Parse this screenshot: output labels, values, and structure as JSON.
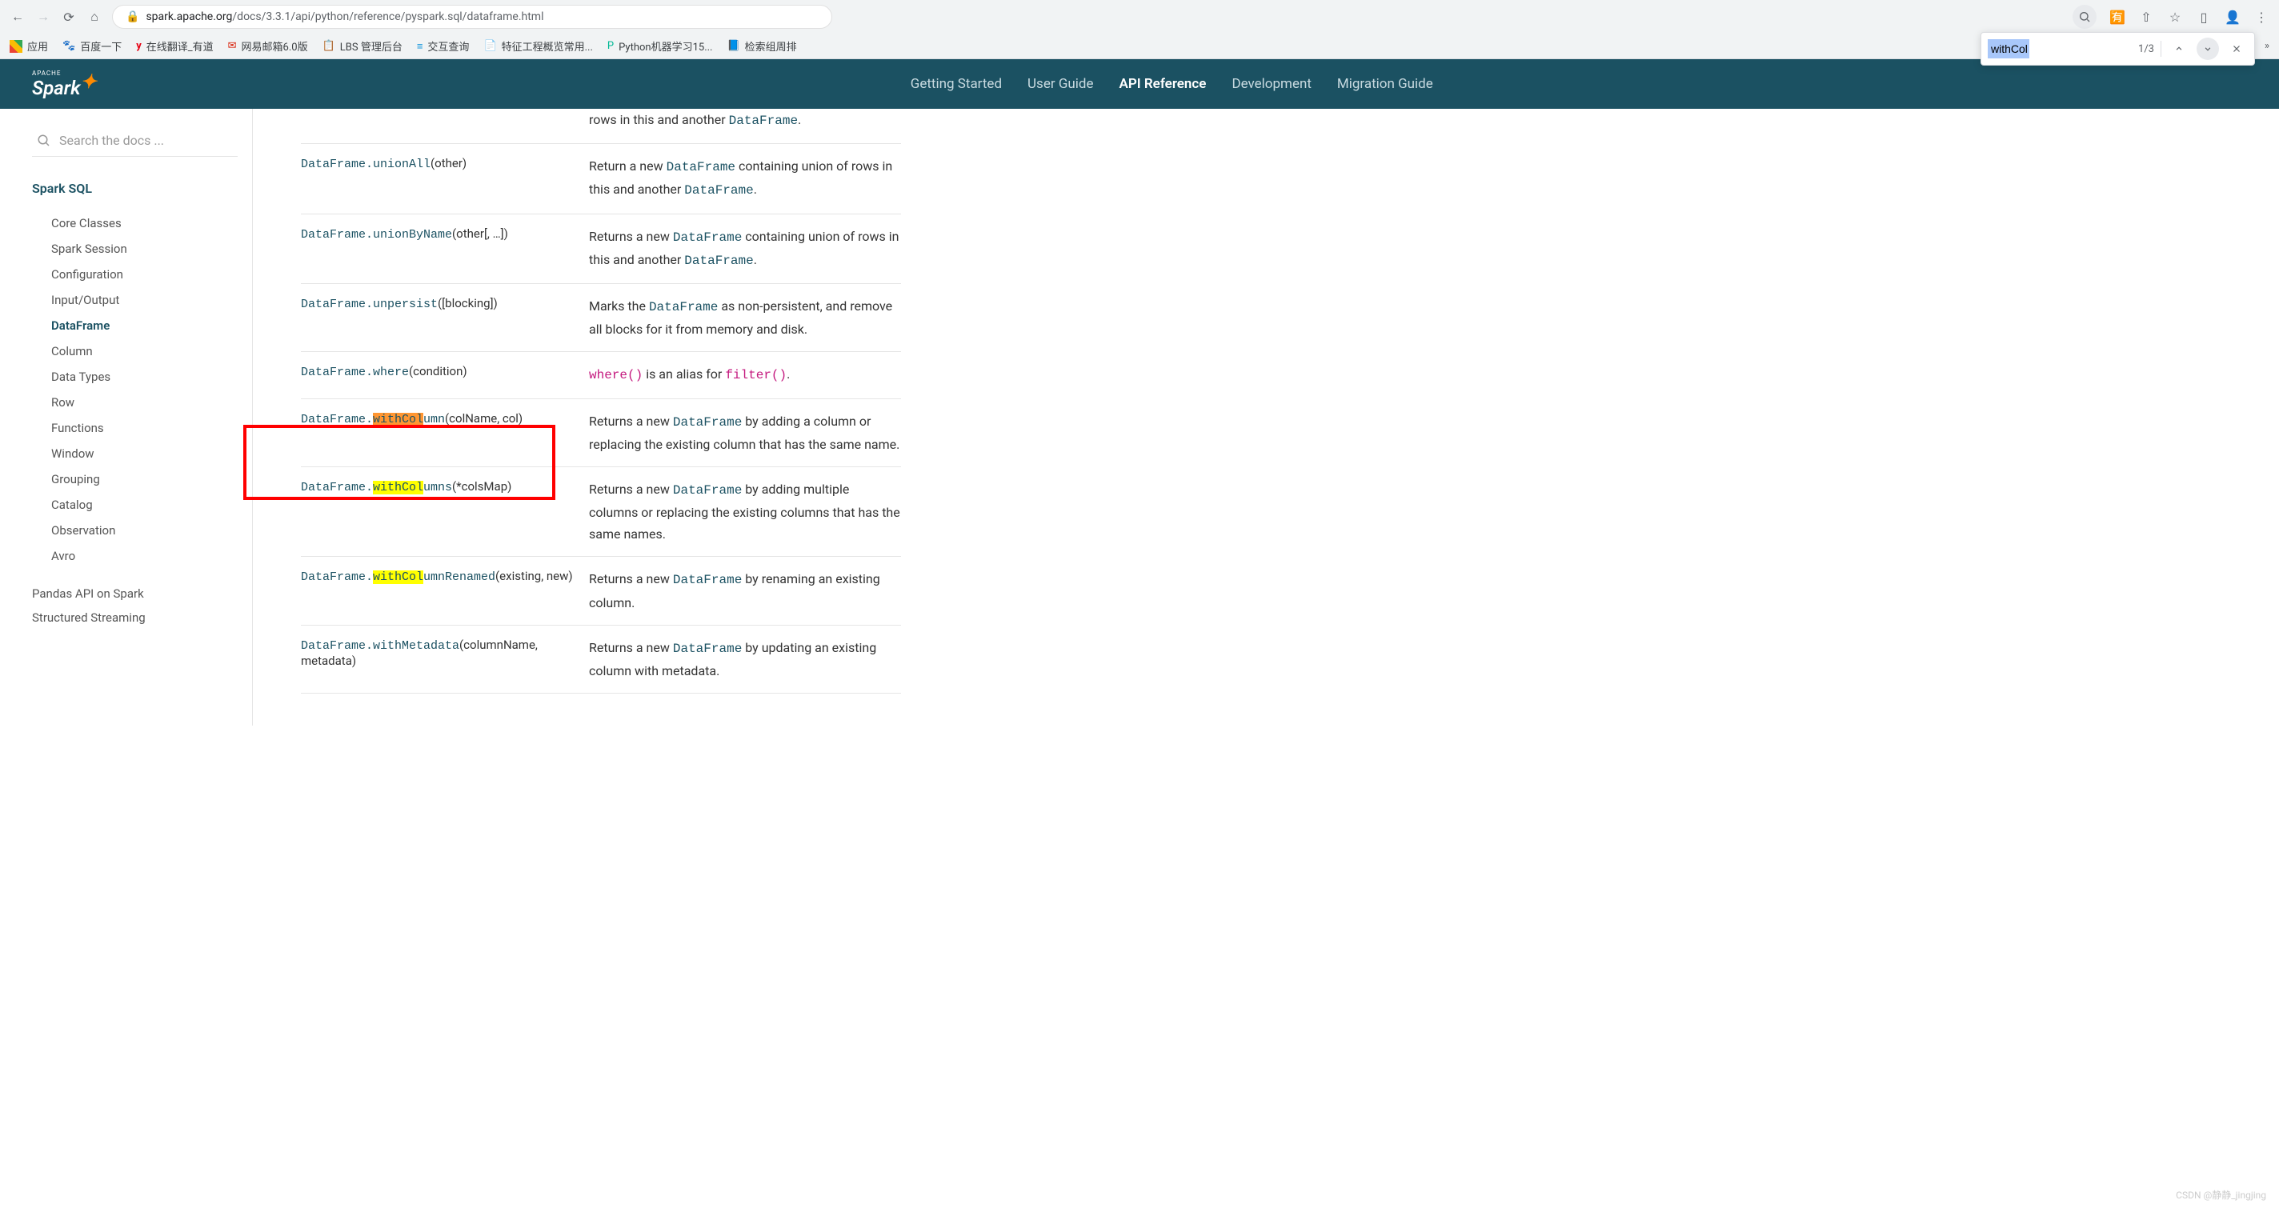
{
  "browser": {
    "url_prefix": "spark.apache.org",
    "url_path": "/docs/3.3.1/api/python/reference/pyspark.sql/dataframe.html"
  },
  "bookmarks": [
    {
      "label": "应用"
    },
    {
      "label": "百度一下"
    },
    {
      "label": "在线翻译_有道"
    },
    {
      "label": "网易邮箱6.0版"
    },
    {
      "label": "LBS 管理后台"
    },
    {
      "label": "交互查询"
    },
    {
      "label": "特征工程概览常用..."
    },
    {
      "label": "Python机器学习15..."
    },
    {
      "label": "检索组周排"
    }
  ],
  "find": {
    "query": "withCol",
    "position": "1/3"
  },
  "header": {
    "brand_small": "APACHE",
    "brand": "Spark",
    "nav": [
      {
        "label": "Getting Started",
        "active": false
      },
      {
        "label": "User Guide",
        "active": false
      },
      {
        "label": "API Reference",
        "active": true
      },
      {
        "label": "Development",
        "active": false
      },
      {
        "label": "Migration Guide",
        "active": false
      }
    ]
  },
  "sidebar": {
    "search_placeholder": "Search the docs ...",
    "section": "Spark SQL",
    "items": [
      {
        "label": "Core Classes",
        "active": false
      },
      {
        "label": "Spark Session",
        "active": false
      },
      {
        "label": "Configuration",
        "active": false
      },
      {
        "label": "Input/Output",
        "active": false
      },
      {
        "label": "DataFrame",
        "active": true
      },
      {
        "label": "Column",
        "active": false
      },
      {
        "label": "Data Types",
        "active": false
      },
      {
        "label": "Row",
        "active": false
      },
      {
        "label": "Functions",
        "active": false
      },
      {
        "label": "Window",
        "active": false
      },
      {
        "label": "Grouping",
        "active": false
      },
      {
        "label": "Catalog",
        "active": false
      },
      {
        "label": "Observation",
        "active": false
      },
      {
        "label": "Avro",
        "active": false
      }
    ],
    "top_items": [
      {
        "label": "Pandas API on Spark"
      },
      {
        "label": "Structured Streaming"
      }
    ]
  },
  "api_rows": [
    {
      "partial_desc_tail": "rows in this and another ",
      "partial_desc_code": "DataFrame",
      "partial_desc_end": "."
    },
    {
      "prefix": "DataFrame.",
      "method": "unionAll",
      "params": "(other)",
      "desc_parts": [
        "Return a new ",
        "DataFrame",
        " containing union of rows in this and another ",
        "DataFrame",
        "."
      ]
    },
    {
      "prefix": "DataFrame.",
      "method": "unionByName",
      "params": "(other[, …])",
      "desc_parts": [
        "Returns a new ",
        "DataFrame",
        " containing union of rows in this and another ",
        "DataFrame",
        "."
      ]
    },
    {
      "prefix": "DataFrame.",
      "method": "unpersist",
      "params": "([blocking])",
      "desc_parts": [
        "Marks the ",
        "DataFrame",
        " as non-persistent, and remove all blocks for it from memory and disk."
      ]
    },
    {
      "prefix": "DataFrame.",
      "method": "where",
      "params": "(condition)",
      "desc_pink1": "where()",
      "desc_mid": " is an alias for ",
      "desc_pink2": "filter()",
      "desc_end": "."
    },
    {
      "prefix": "DataFrame.",
      "hl": "withCol",
      "hl_type": "orange",
      "method_tail": "umn",
      "params": "(colName, col)",
      "desc_parts": [
        "Returns a new ",
        "DataFrame",
        " by adding a column or replacing the existing column that has the same name."
      ]
    },
    {
      "prefix": "DataFrame.",
      "hl": "withCol",
      "hl_type": "yellow",
      "method_tail": "umns",
      "params": "(*colsMap)",
      "desc_parts": [
        "Returns a new ",
        "DataFrame",
        " by adding multiple columns or replacing the existing columns that has the same names."
      ],
      "boxed": true
    },
    {
      "prefix": "DataFrame.",
      "hl": "withCol",
      "hl_type": "yellow",
      "method_tail": "umnRenamed",
      "params": "(existing, new)",
      "desc_parts": [
        "Returns a new ",
        "DataFrame",
        " by renaming an existing column."
      ]
    },
    {
      "prefix": "DataFrame.",
      "method": "withMetadata",
      "params": "(columnName, metadata)",
      "desc_parts": [
        "Returns a new ",
        "DataFrame",
        " by updating an existing column with metadata."
      ]
    }
  ],
  "watermark": "CSDN @静静_jingjing"
}
